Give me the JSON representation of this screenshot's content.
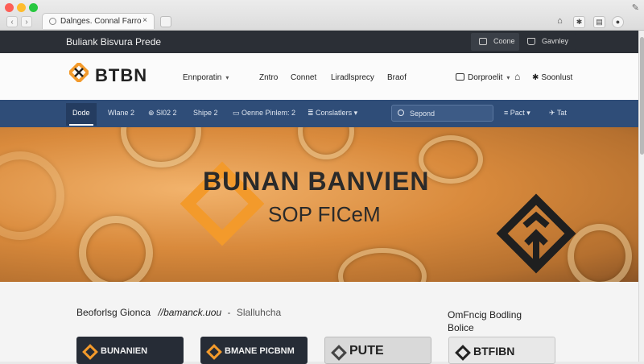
{
  "browser": {
    "tab_title": "Dalnges. Connal Farro",
    "tab_close": "×",
    "new_tab_icon": "plus-icon",
    "colors": {
      "close": "#fd5f57",
      "minimize": "#febc2e",
      "zoom": "#28c840"
    }
  },
  "topbar": {
    "title": "Buliank Bisvura Prede",
    "btn_one": "Coone",
    "btn_two": "Gavnley"
  },
  "header": {
    "logo_text": "BTBN",
    "nav": [
      {
        "label": "Ennporatin",
        "chevron": "▾"
      },
      {
        "label": "Zntro"
      },
      {
        "label": "Connet"
      },
      {
        "label": "Liradlsprecy"
      },
      {
        "label": "Braof"
      }
    ],
    "right_dropdown": "Dorproelit",
    "right_link": "Soonlust"
  },
  "subnav": {
    "items": [
      "Dode",
      "Wlane 2",
      "Sl02 2",
      "Shipe 2",
      "Oenne Pinlem: 2",
      "Conslatlers"
    ],
    "search_placeholder": "Sepond",
    "right_dropdown": "Pact",
    "right_link": "Tat"
  },
  "hero": {
    "title": "BUNAN BANVIEN",
    "subtitle": "SOP FICeM",
    "accent": "#f39a2b"
  },
  "content": {
    "heading": "Beoforlsg Gionca",
    "heading_link": "//bamanck.uou",
    "heading_sep": "-",
    "heading_extra": "Slalluhcha",
    "side_line1": "OmFncig Bodling",
    "side_line2": "Bolice",
    "cards": [
      {
        "label": "BUNANIEN"
      },
      {
        "label": "BMANE PICBNM"
      },
      {
        "label": "PUTE"
      },
      {
        "label": "BTFIBN"
      }
    ]
  }
}
